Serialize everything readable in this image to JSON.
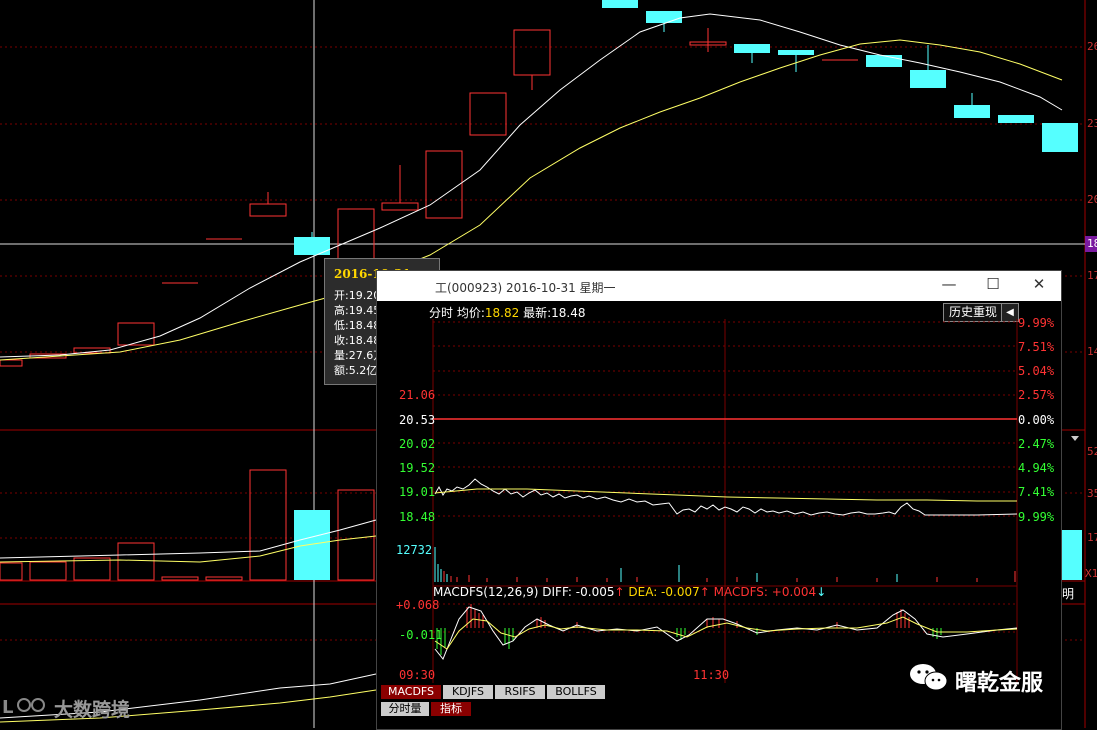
{
  "colors": {
    "up": "#ff3333",
    "down": "#55ffff",
    "ma1": "#ffffff",
    "ma2": "#ffff66",
    "grid": "#7a0000",
    "accent": "#ffd700"
  },
  "right_axis": {
    "labels": [
      "26",
      "23",
      "20",
      "18",
      "17",
      "14"
    ],
    "vol": [
      "52",
      "35",
      "17",
      "X1"
    ],
    "extra": "明"
  },
  "tooltip": {
    "date": "2016-10-31,一",
    "rows": [
      {
        "k": "开",
        "v": "19.20"
      },
      {
        "k": "高",
        "v": "19.45"
      },
      {
        "k": "低",
        "v": "18.48"
      },
      {
        "k": "收",
        "v": "18.48"
      },
      {
        "k": "量",
        "v": "27.6万"
      },
      {
        "k": "额",
        "v": "5.2亿"
      }
    ]
  },
  "popup": {
    "title": "工(000923) 2016-10-31 星期一",
    "header": {
      "mode": "分时",
      "avg_label": "均价:",
      "avg": "18.82",
      "last_label": "最新:",
      "last": "18.48"
    },
    "replay_label": "历史重现",
    "price_labels": [
      "21.06",
      "20.53",
      "20.02",
      "19.52",
      "19.01",
      "18.48"
    ],
    "pct_labels": [
      "9.99%",
      "7.51%",
      "5.04%",
      "2.57%",
      "0.00%",
      "2.47%",
      "4.94%",
      "7.41%",
      "9.99%"
    ],
    "volume_label": "12732",
    "macd": {
      "label": "MACDFS(12,26,9)",
      "diff": "DIFF: -0.005",
      "dea": "DEA: -0.007",
      "macdfs": "MACDFS: +0.004",
      "top": "+0.068",
      "mid": "-0.011"
    },
    "time_labels": [
      "09:30",
      "11:30"
    ]
  },
  "tabs": [
    {
      "label": "MACDFS",
      "active": true
    },
    {
      "label": "KDJFS",
      "active": false
    },
    {
      "label": "RSIFS",
      "active": false
    },
    {
      "label": "BOLLFS",
      "active": false
    }
  ],
  "subtabs": [
    {
      "label": "分时量",
      "active": false
    },
    {
      "label": "指标",
      "active": true
    }
  ],
  "watermarks": {
    "left": "大数跨境",
    "right": "曙乾金服"
  }
}
